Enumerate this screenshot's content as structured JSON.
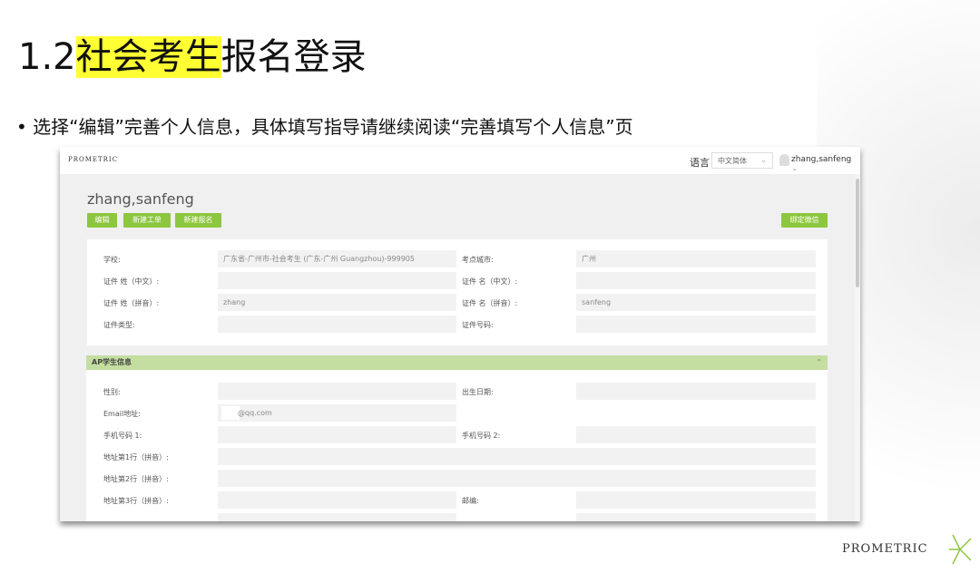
{
  "slide": {
    "title_prefix": "1.2",
    "title_highlight": "社会考生",
    "title_suffix": "报名登录",
    "bullet": "• 选择“编辑”完善个人信息，具体填写指导请继续阅读“完善填写个人信息”页",
    "footer_logo": "PROMETRIC"
  },
  "app": {
    "logo": "PROMETRIC",
    "language_label": "语言",
    "language_value": "中文简体",
    "user": "zhang,sanfeng",
    "profile_name": "zhang,sanfeng",
    "buttons": {
      "edit": "编辑",
      "new_ticket": "新建工单",
      "new_registration": "新建报名",
      "bind_wechat": "绑定微信"
    },
    "basic": {
      "school_label": "学校:",
      "school_value": "广东省-广州市-社会考生 (广东-广州 Guangzhou)-999905",
      "city_label": "考点城市:",
      "city_value": "广州",
      "surname_cn_label": "证件 姓（中文）:",
      "given_cn_label": "证件 名（中文）:",
      "surname_py_label": "证件 姓（拼音）:",
      "surname_py_value": "zhang",
      "given_py_label": "证件 名（拼音）:",
      "given_py_value": "sanfeng",
      "idtype_label": "证件类型:",
      "idno_label": "证件号码:"
    },
    "ap": {
      "header": "AP学生信息",
      "gender_label": "性别:",
      "dob_label": "出生日期:",
      "email_label": "Email地址:",
      "email_value": "@qq.com",
      "phone1_label": "手机号码 1:",
      "phone2_label": "手机号码 2:",
      "addr1_label": "地址第1行（拼音）:",
      "addr2_label": "地址第2行（拼音）:",
      "addr3_label": "地址第3行（拼音）:",
      "zip_label": "邮编:"
    }
  }
}
